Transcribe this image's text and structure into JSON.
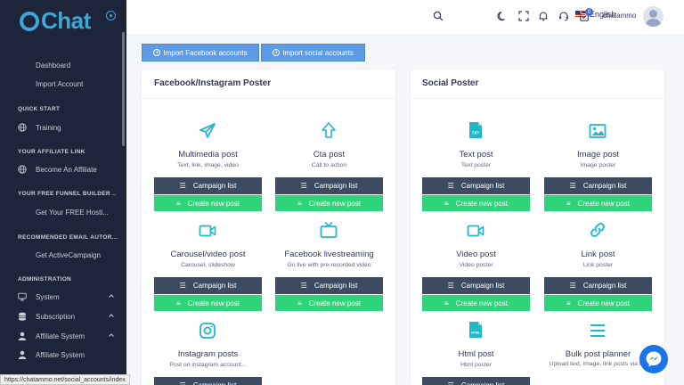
{
  "app": {
    "name": "Chat"
  },
  "colors": {
    "sidebar": "#1c2539",
    "accent": "#3fa7d6",
    "campaign_btn": "#3c4a62",
    "create_btn": "#2ed47a",
    "import_btn": "#5e9be5"
  },
  "sidebar": {
    "items_top": [
      {
        "label": "Dashboard"
      },
      {
        "label": "Import Account"
      }
    ],
    "sections": [
      {
        "heading": "QUICK START",
        "item": "Training",
        "icon": "globe-icon"
      },
      {
        "heading": "YOUR AFFILIATE LINK",
        "item": "Become An Affiliate",
        "icon": "globe-icon"
      },
      {
        "heading": "YOUR FREE FUNNEL BUILDER ..",
        "item": "Get Your FREE Hosti..."
      },
      {
        "heading": "RECOMMENDED EMAIL AUTOR...",
        "item": "Get ActiveCampaign"
      }
    ],
    "admin_heading": "ADMINISTRATION",
    "admin_items": [
      {
        "label": "System",
        "icon": "monitor-icon"
      },
      {
        "label": "Subscription",
        "icon": "database-icon"
      },
      {
        "label": "Affiliate System",
        "icon": "user-icon"
      },
      {
        "label": "Affiliate System",
        "icon": "user-icon"
      }
    ]
  },
  "topbar": {
    "language": "English",
    "notification_count": "0",
    "username": "chatammo"
  },
  "import_buttons": [
    {
      "label": "Import Facebook accounts"
    },
    {
      "label": "Import social accounts"
    }
  ],
  "cards": [
    {
      "title": "Facebook/Instagram Poster",
      "items": [
        {
          "title": "Multimedia post",
          "subtitle": "Text, link, image, video",
          "icon": "paper-plane-icon"
        },
        {
          "title": "Cta post",
          "subtitle": "Call to action",
          "icon": "arrow-up-icon"
        },
        {
          "title": "Carousel/video post",
          "subtitle": "Carousel, slideshow",
          "icon": "video-icon"
        },
        {
          "title": "Facebook livestreaming",
          "subtitle": "Go live with pre-recorded video",
          "icon": "tv-icon"
        },
        {
          "title": "Instagram posts",
          "subtitle": "Post on instagram account...",
          "icon": "instagram-icon"
        }
      ]
    },
    {
      "title": "Social Poster",
      "items": [
        {
          "title": "Text post",
          "subtitle": "Text poster",
          "icon": "txt-file-icon"
        },
        {
          "title": "Image post",
          "subtitle": "Image poster",
          "icon": "image-icon"
        },
        {
          "title": "Video post",
          "subtitle": "Video poster",
          "icon": "video-icon"
        },
        {
          "title": "Link post",
          "subtitle": "Link poster",
          "icon": "link-icon"
        },
        {
          "title": "Html post",
          "subtitle": "Html poster",
          "icon": "html-file-icon"
        },
        {
          "title": "Bulk post planner",
          "subtitle": "Upload text, image, link posts via file",
          "icon": "list-icon"
        }
      ]
    }
  ],
  "buttons": {
    "campaign_list": "Campaign list",
    "create_new": "Create new post"
  },
  "statusbar": {
    "url": "https://chatammo.net/social_accounts/index"
  }
}
